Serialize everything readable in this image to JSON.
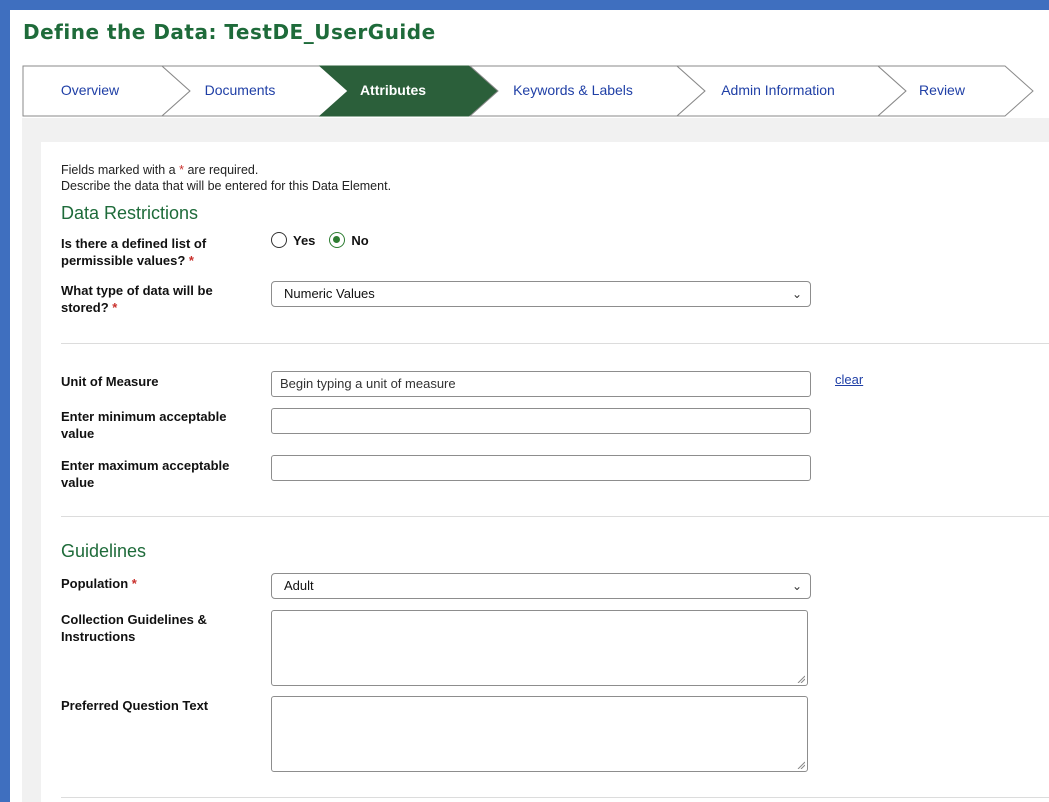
{
  "page": {
    "title": "Define the Data: TestDE_UserGuide"
  },
  "wizard": {
    "steps": [
      {
        "label": "Overview",
        "active": false
      },
      {
        "label": "Documents",
        "active": false
      },
      {
        "label": "Attributes",
        "active": true
      },
      {
        "label": "Keywords & Labels",
        "active": false
      },
      {
        "label": "Admin Information",
        "active": false
      },
      {
        "label": "Review",
        "active": false
      }
    ]
  },
  "form": {
    "required_note_prefix": "Fields marked with a ",
    "required_star": "*",
    "required_note_suffix": " are required.",
    "description_note": "Describe the data that will be entered for this Data Element.",
    "data_restrictions": {
      "title": "Data Restrictions",
      "permissible_label": "Is there a defined list of permissible values?",
      "permissible_options": [
        "Yes",
        "No"
      ],
      "permissible_selected": "No",
      "type_label": "What type of data will be stored?",
      "type_value": "Numeric Values"
    },
    "measure": {
      "unit_label": "Unit of Measure",
      "unit_placeholder": "Begin typing a unit of measure",
      "clear_label": "clear",
      "min_label": "Enter minimum acceptable value",
      "min_value": "",
      "max_label": "Enter maximum acceptable value",
      "max_value": ""
    },
    "guidelines": {
      "title": "Guidelines",
      "population_label": "Population",
      "population_value": "Adult",
      "collection_label": "Collection Guidelines & Instructions",
      "collection_value": "",
      "question_label": "Preferred Question Text",
      "question_value": ""
    }
  },
  "colors": {
    "brand_green": "#1e6b3a",
    "active_step": "#2b5f3a",
    "frame_blue": "#3f6fbf",
    "link_blue": "#1f3fa6",
    "required_red": "#c9302c"
  }
}
